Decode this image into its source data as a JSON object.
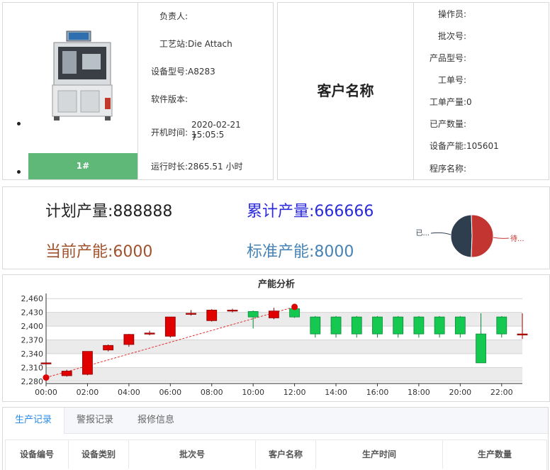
{
  "device": {
    "badge": "1#",
    "fields": [
      {
        "label": "负责人:",
        "value": ""
      },
      {
        "label": "工艺站:",
        "value": "Die Attach"
      },
      {
        "label": "设备型号:",
        "value": "A8283"
      },
      {
        "label": "软件版本:",
        "value": ""
      },
      {
        "label": "开机时间:",
        "value_line1": "2020-02-21 15:05:5",
        "value_line2": "7"
      },
      {
        "label": "运行时长:",
        "value": "2865.51 小时"
      }
    ]
  },
  "customer": {
    "name": "客户名称",
    "fields": [
      {
        "label": "操作员:",
        "value": ""
      },
      {
        "label": "批次号:",
        "value": ""
      },
      {
        "label": "产品型号:",
        "value": ""
      },
      {
        "label": "工单号:",
        "value": ""
      },
      {
        "label": "工单产量:",
        "value": "0"
      },
      {
        "label": "已产数量:",
        "value": ""
      },
      {
        "label": "设备产能:",
        "value": "105601"
      },
      {
        "label": "程序名称:",
        "value": ""
      }
    ]
  },
  "summary": {
    "plan_label": "计划产量:",
    "plan_value": "888888",
    "total_label": "累计产量:",
    "total_value": "666666",
    "cur_label": "当前产能:",
    "cur_value": "6000",
    "std_label": "标准产能:",
    "std_value": "8000",
    "colors": {
      "plan": "#222222",
      "total": "#2b2bdc",
      "cur": "#a0522d",
      "std": "#4682b4"
    }
  },
  "pie": {
    "slices": [
      {
        "label": "已...",
        "value": 49,
        "color": "#2f3e4e"
      },
      {
        "label": "待...",
        "value": 51,
        "color": "#c23531"
      }
    ]
  },
  "chart_data": {
    "type": "candlestick",
    "title": "产能分析",
    "x_ticks": [
      "00:00",
      "02:00",
      "04:00",
      "06:00",
      "08:00",
      "10:00",
      "12:00",
      "14:00",
      "16:00",
      "18:00",
      "20:00",
      "22:00"
    ],
    "y_ticks": [
      2280,
      2310,
      2340,
      2370,
      2400,
      2430,
      2460
    ],
    "ylim": [
      2275,
      2465
    ],
    "xlim": [
      0,
      23
    ],
    "candles": [
      {
        "x": 0,
        "open": 2320,
        "close": 2320,
        "low": 2320,
        "high": 2320
      },
      {
        "x": 1,
        "open": 2292,
        "close": 2302,
        "low": 2290,
        "high": 2305
      },
      {
        "x": 2,
        "open": 2295,
        "close": 2345,
        "low": 2293,
        "high": 2345
      },
      {
        "x": 3,
        "open": 2348,
        "close": 2358,
        "low": 2345,
        "high": 2360
      },
      {
        "x": 4,
        "open": 2360,
        "close": 2382,
        "low": 2355,
        "high": 2383
      },
      {
        "x": 5,
        "open": 2385,
        "close": 2385,
        "low": 2380,
        "high": 2390
      },
      {
        "x": 6,
        "open": 2378,
        "close": 2420,
        "low": 2375,
        "high": 2420
      },
      {
        "x": 7,
        "open": 2428,
        "close": 2428,
        "low": 2423,
        "high": 2435
      },
      {
        "x": 8,
        "open": 2412,
        "close": 2435,
        "low": 2410,
        "high": 2437
      },
      {
        "x": 9,
        "open": 2435,
        "close": 2435,
        "low": 2430,
        "high": 2438
      },
      {
        "x": 10,
        "open": 2432,
        "close": 2420,
        "low": 2395,
        "high": 2434
      },
      {
        "x": 11,
        "open": 2418,
        "close": 2433,
        "low": 2415,
        "high": 2440
      },
      {
        "x": 12,
        "open": 2438,
        "close": 2420,
        "low": 2418,
        "high": 2440
      },
      {
        "x": 13,
        "open": 2420,
        "close": 2383,
        "low": 2375,
        "high": 2422
      },
      {
        "x": 14,
        "open": 2420,
        "close": 2383,
        "low": 2375,
        "high": 2422
      },
      {
        "x": 15,
        "open": 2420,
        "close": 2383,
        "low": 2375,
        "high": 2422
      },
      {
        "x": 16,
        "open": 2420,
        "close": 2383,
        "low": 2375,
        "high": 2422
      },
      {
        "x": 17,
        "open": 2420,
        "close": 2383,
        "low": 2375,
        "high": 2422
      },
      {
        "x": 18,
        "open": 2420,
        "close": 2383,
        "low": 2375,
        "high": 2422
      },
      {
        "x": 19,
        "open": 2420,
        "close": 2383,
        "low": 2375,
        "high": 2422
      },
      {
        "x": 20,
        "open": 2420,
        "close": 2383,
        "low": 2375,
        "high": 2422
      },
      {
        "x": 21,
        "open": 2383,
        "close": 2320,
        "low": 2320,
        "high": 2428
      },
      {
        "x": 22,
        "open": 2420,
        "close": 2383,
        "low": 2375,
        "high": 2422
      },
      {
        "x": 23,
        "open": 2383,
        "close": 2383,
        "low": 2372,
        "high": 2428
      }
    ],
    "markers": [
      {
        "x": 0,
        "y": 2288
      },
      {
        "x": 12,
        "y": 2442
      }
    ],
    "up_color": "#e00000",
    "down_color": "#14c850",
    "trend_color": "#e03030"
  },
  "tabs": [
    "生产记录",
    "警报记录",
    "报修信息"
  ],
  "table_headers": [
    "设备编号",
    "设备类别",
    "批次号",
    "客户名称",
    "生产时间",
    "生产数量"
  ]
}
